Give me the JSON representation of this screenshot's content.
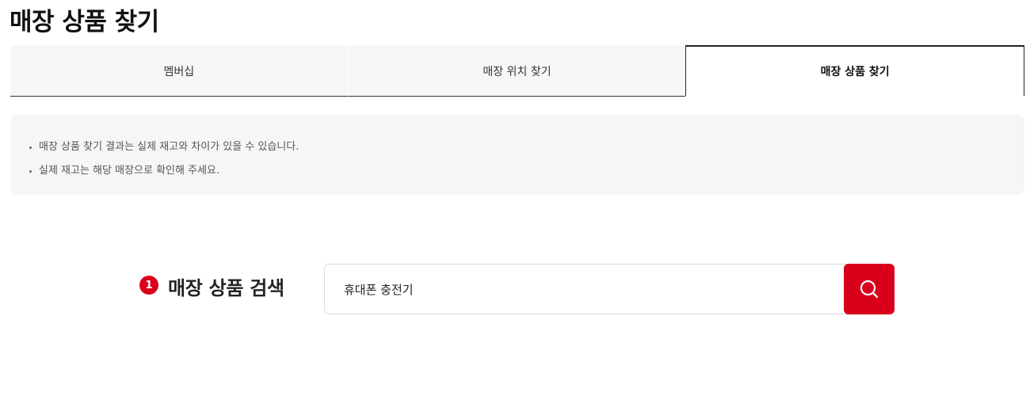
{
  "page": {
    "title": "매장 상품 찾기"
  },
  "tabs": [
    {
      "label": "멤버십",
      "active": false
    },
    {
      "label": "매장 위치 찾기",
      "active": false
    },
    {
      "label": "매장 상품 찾기",
      "active": true
    }
  ],
  "notice": {
    "items": [
      "매장 상품 찾기 결과는 실제 재고와 차이가 있을 수 있습니다.",
      "실제 재고는 해당 매장으로 확인해 주세요."
    ]
  },
  "search": {
    "step_number": "1",
    "label": "매장 상품 검색",
    "value": "휴대폰 충전기",
    "button_icon": "search-icon"
  },
  "colors": {
    "accent": "#d9001b",
    "panel_bg": "#f5f6f8"
  }
}
